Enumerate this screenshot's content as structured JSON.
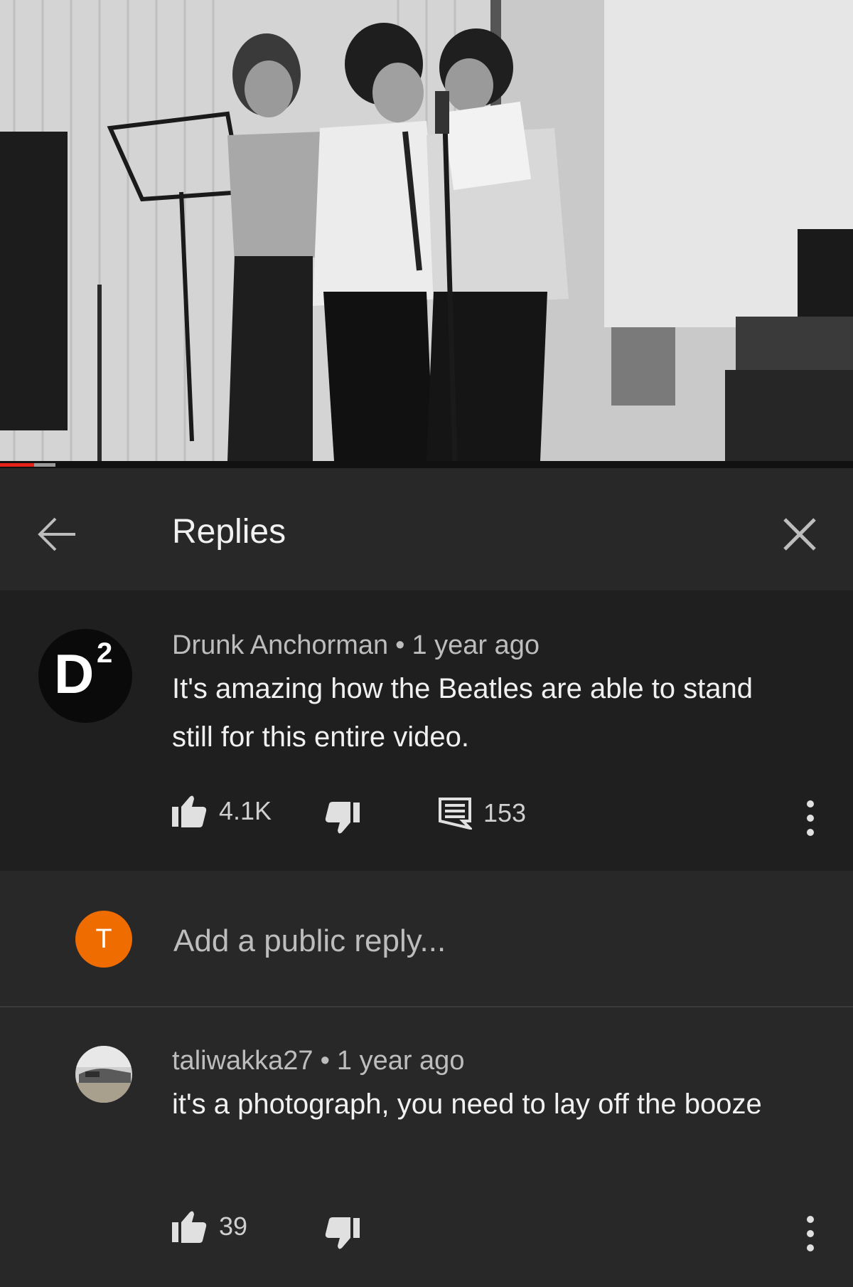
{
  "player": {
    "progress_fraction": 0.04,
    "buffer_fraction": 0.065
  },
  "header": {
    "title": "Replies",
    "back_icon": "arrow-left-icon",
    "close_icon": "close-icon"
  },
  "original_comment": {
    "author": "Drunk Anchorman",
    "separator": "•",
    "time": "1 year ago",
    "text": "It's amazing how the Beatles are able to stand still for this entire video.",
    "avatar_letter": "D",
    "avatar_superscript": "2",
    "likes": "4.1K",
    "replies": "153"
  },
  "reply_box": {
    "avatar_letter": "T",
    "avatar_color": "#ef6c00",
    "placeholder": "Add a public reply..."
  },
  "reply": {
    "author": "taliwakka27",
    "separator": "•",
    "time": "1 year ago",
    "text": "it's a photograph, you need to lay off the booze",
    "likes": "39"
  },
  "colors": {
    "background": "#282828",
    "highlight_background": "#1f1f1f",
    "text": "#f1f1f1",
    "secondary_text": "#bdbdbd",
    "progress": "#e62117"
  }
}
